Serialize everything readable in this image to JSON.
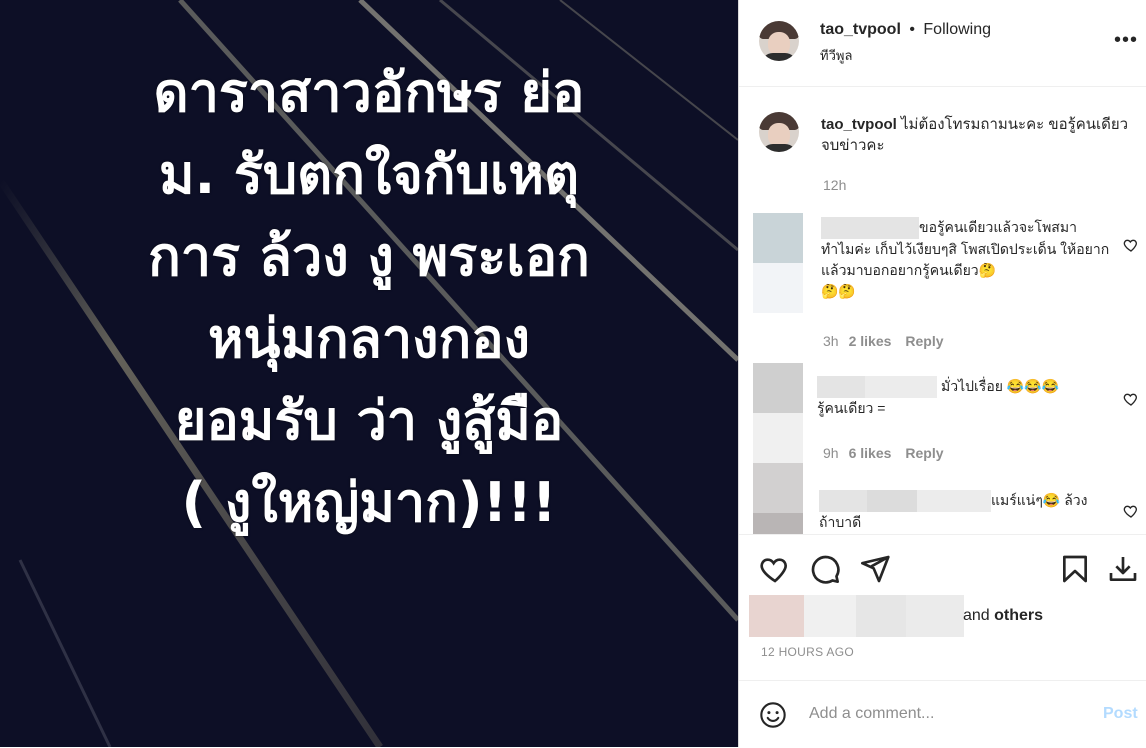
{
  "image": {
    "headline_lines": [
      "ดาราสาวอักษร ย่อ",
      "ม. รับตกใจกับเหตุ",
      "การ ล้วง งู พระเอก",
      "หนุ่มกลางกอง",
      "ยอมรับ ว่า งูสู้มือ",
      "( งูใหญ่มาก)!!!"
    ],
    "background_color": "#0d0f26"
  },
  "header": {
    "username": "tao_tvpool",
    "separator": "•",
    "follow_status": "Following",
    "subtitle": "ทีวีพูล",
    "more_icon": "more-horizontal-icon",
    "more_label": "•••"
  },
  "caption": {
    "username": "tao_tvpool",
    "text": "ไม่ต้องโทรมถามนะคะ ขอรู้คนเดียวจบข่าวคะ",
    "time": "12h"
  },
  "comments": [
    {
      "text_line1": "ขอรู้คนเดียวแล้วจะโพสมา",
      "text_rest": "ทำไมค่ะ เก็บไว้เงียบๆสิ โพสเปิดประเด็น ให้อยากแล้วมาบอกอยากรู้คนเดียว🤔",
      "text_emoji": "🤔🤔",
      "time": "3h",
      "likes": "2 likes",
      "reply": "Reply"
    },
    {
      "text_line1": "มั่วไปเรื่อย 😂😂😂",
      "text_rest": "รู้คนเดียว =",
      "time": "9h",
      "likes": "6 likes",
      "reply": "Reply"
    },
    {
      "text_line1": "แมร์แน่ๆ😂 ล้วง",
      "text_rest": "ถ้าบาดี"
    }
  ],
  "actions": {
    "icons": [
      "heart-icon",
      "comment-icon",
      "share-icon",
      "bookmark-icon",
      "download-icon"
    ]
  },
  "likes": {
    "and_text": "and ",
    "others_text": "others"
  },
  "timestamp": "12 HOURS AGO",
  "add_comment": {
    "placeholder": "Add a comment...",
    "post_label": "Post",
    "emoji_icon": "emoji-icon"
  },
  "colors": {
    "text": "#262626",
    "secondary": "#8e8e8e",
    "post_disabled": "#b3dbff",
    "border": "#dbdbdb"
  }
}
